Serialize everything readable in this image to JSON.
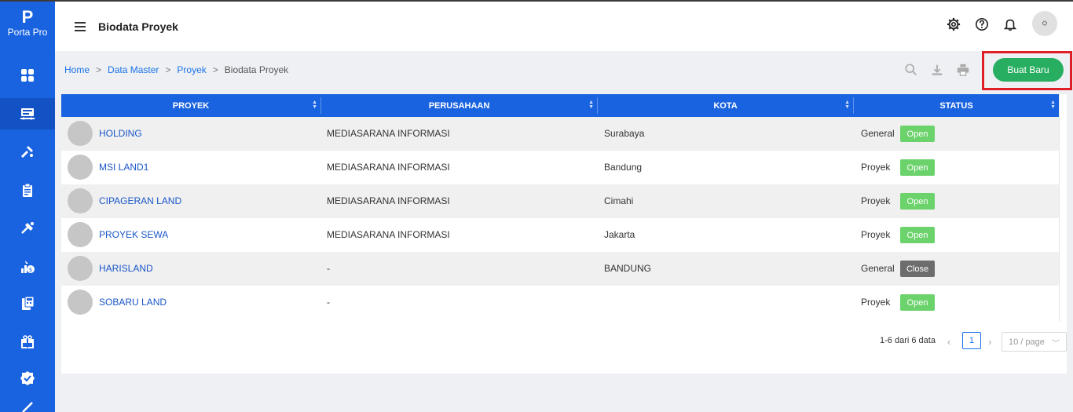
{
  "app": {
    "logo_mark": "P",
    "logo_name": "Porta Pro"
  },
  "header": {
    "title": "Biodata Proyek",
    "avatar_text": "⛭"
  },
  "breadcrumb": {
    "items": [
      "Home",
      "Data Master",
      "Proyek"
    ],
    "current": "Biodata Proyek",
    "separator": ">"
  },
  "toolbar": {
    "new_label": "Buat Baru"
  },
  "table": {
    "columns": [
      "PROYEK",
      "PERUSAHAAN",
      "KOTA",
      "STATUS"
    ],
    "rows": [
      {
        "proyek": "HOLDING",
        "perusahaan": "MEDIASARANA INFORMASI",
        "kota": "Surabaya",
        "tipe": "General",
        "status": "Open"
      },
      {
        "proyek": "MSI LAND1",
        "perusahaan": "MEDIASARANA INFORMASI",
        "kota": "Bandung",
        "tipe": "Proyek",
        "status": "Open"
      },
      {
        "proyek": "CIPAGERAN LAND",
        "perusahaan": "MEDIASARANA INFORMASI",
        "kota": "Cimahi",
        "tipe": "Proyek",
        "status": "Open"
      },
      {
        "proyek": "PROYEK SEWA",
        "perusahaan": "MEDIASARANA INFORMASI",
        "kota": "Jakarta",
        "tipe": "Proyek",
        "status": "Open"
      },
      {
        "proyek": "HARISLAND",
        "perusahaan": "-",
        "kota": "BANDUNG",
        "tipe": "General",
        "status": "Close"
      },
      {
        "proyek": "SOBARU LAND",
        "perusahaan": "-",
        "kota": "",
        "tipe": "Proyek",
        "status": "Open"
      }
    ]
  },
  "pagination": {
    "info": "1-6 dari 6 data",
    "current_page": "1",
    "page_size": "10 / page"
  },
  "colors": {
    "sidebar": "#1a63e0",
    "header_row": "#1a63e0",
    "new_button": "#27ae60",
    "open_badge": "#6cd26c",
    "close_badge": "#6d6d6d",
    "highlight": "#e01e26"
  },
  "icons": {
    "sidebar": [
      "dashboard-icon",
      "server-icon",
      "tools-icon",
      "clipboard-icon",
      "hammer-icon",
      "finance-icon",
      "calculator-icon",
      "gift-icon",
      "verified-icon"
    ],
    "header": [
      "gear-icon",
      "help-icon",
      "bell-icon"
    ],
    "toolbar": [
      "search-icon",
      "download-icon",
      "print-icon"
    ]
  }
}
